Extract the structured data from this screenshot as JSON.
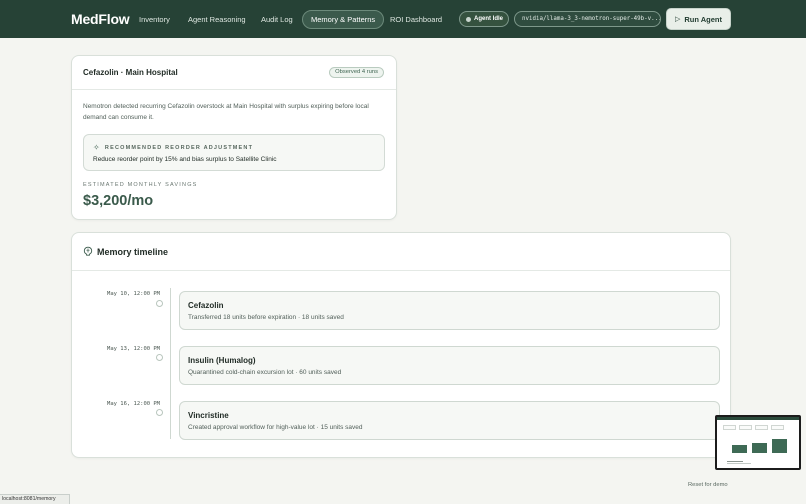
{
  "nav": {
    "brand": "MedFlow",
    "links": [
      {
        "label": "Inventory"
      },
      {
        "label": "Agent Reasoning"
      },
      {
        "label": "Audit Log"
      },
      {
        "label": "Memory & Patterns",
        "active": true
      },
      {
        "label": "ROI Dashboard"
      }
    ],
    "agent_status": "Agent Idle",
    "model": "nvidia/llama-3_3-nemotron-super-49b-v...",
    "run_button": "Run Agent",
    "accent_color": "#264236"
  },
  "pattern_card": {
    "title": "Cefazolin · Main Hospital",
    "badge": "Observed 4 runs",
    "description": "Nemotron detected recurring Cefazolin overstock at Main Hospital with surplus expiring before local demand can consume it.",
    "recommendation_label": "RECOMMENDED REORDER ADJUSTMENT",
    "recommendation_text": "Reduce reorder point by 15% and bias surplus to Satellite Clinic",
    "savings_label": "ESTIMATED MONTHLY SAVINGS",
    "savings_value": "$3,200/mo"
  },
  "timeline": {
    "title": "Memory timeline",
    "events": [
      {
        "date": "May 10, 12:00 PM",
        "name": "Cefazolin",
        "detail": "Transferred 18 units before expiration · 18 units saved"
      },
      {
        "date": "May 13, 12:00 PM",
        "name": "Insulin (Humalog)",
        "detail": "Quarantined cold-chain excursion lot · 60 units saved"
      },
      {
        "date": "May 16, 12:00 PM",
        "name": "Vincristine",
        "detail": "Created approval workflow for high-value lot · 15 units saved"
      }
    ]
  },
  "footer": {
    "reset_link": "Reset for demo",
    "status_url": "localhost:8081/memory"
  }
}
